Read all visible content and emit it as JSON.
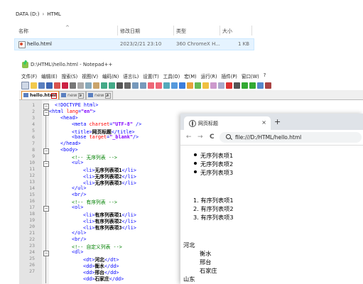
{
  "explorer": {
    "breadcrumb": [
      "DATA (D:)",
      "HTML"
    ],
    "columns": {
      "name": "名称",
      "modified": "修改日期",
      "type": "类型",
      "size": "大小"
    },
    "file": {
      "name": "hello.html",
      "modified": "2023/2/21 23:10",
      "type": "360 ChromeX H...",
      "size": "1 KB"
    }
  },
  "notepad": {
    "title": "D:\\HTML\\hello.html - Notepad++",
    "menu": [
      "文件(F)",
      "编辑(E)",
      "搜索(S)",
      "视图(V)",
      "编码(N)",
      "语言(L)",
      "设置(T)",
      "工具(O)",
      "宏(M)",
      "运行(R)",
      "插件(P)",
      "窗口(W)",
      "?"
    ],
    "tabs": [
      "hello.html",
      "new 1",
      "new 2"
    ],
    "line_numbers": [
      "1",
      "2",
      "3",
      "4",
      "5",
      "6",
      "7",
      "8",
      "9",
      "10",
      "11",
      "12",
      "13",
      "14",
      "15",
      "16",
      "17",
      "18",
      "19",
      "20",
      "21",
      "22",
      "23",
      "24",
      "25",
      "26",
      "27"
    ],
    "code": {
      "l1": "<!DOCTYPE html>",
      "l2a": "<html ",
      "l2b": "lang",
      "l2c": "=",
      "l2d": "\"en\"",
      "l2e": ">",
      "l3": "<head>",
      "l4a": "<meta ",
      "l4b": "charset",
      "l4c": "=",
      "l4d": "\"UTF-8\"",
      "l4e": " />",
      "l5a": "<title>",
      "l5b": "网页标题",
      "l5c": "</title>",
      "l6a": "<base ",
      "l6b": "target",
      "l6c": "=",
      "l6d": "\"_blank\"",
      "l6e": "/>",
      "l7": "</head>",
      "l8": "<body>",
      "l9": "<!-- 无序列表 -->",
      "l10": "<ul>",
      "l11a": "<li>",
      "l11b": "无序列表项1",
      "l11c": "</li>",
      "l12a": "<li>",
      "l12b": "无序列表项2",
      "l12c": "</li>",
      "l13a": "<li>",
      "l13b": "无序列表项3",
      "l13c": "</li>",
      "l14": "</ul>",
      "l15": "<br/>",
      "l16": "<!-- 有序列表 -->",
      "l17": "<ol>",
      "l18a": "<li>",
      "l18b": "有序列表项1",
      "l18c": "</li>",
      "l19a": "<li>",
      "l19b": "有序列表项2",
      "l19c": "</li>",
      "l20a": "<li>",
      "l20b": "有序列表项3",
      "l20c": "</li>",
      "l21": "</ol>",
      "l22": "<br/>",
      "l23": "<!-- 自定义列表 -->",
      "l24": "<dl>",
      "l25a": "<dt>",
      "l25b": "河北",
      "l25c": "</dt>",
      "l26a": "<dd>",
      "l26b": "衡水",
      "l26c": "</dd>",
      "l27a": "<dd>",
      "l27b": "邢台",
      "l27c": "</dd>",
      "l28a": "<dd>",
      "l28b": "石家庄",
      "l28c": "</dd>"
    }
  },
  "browser": {
    "tab_title": "网页标题",
    "close": "×",
    "new_tab": "+",
    "back": "←",
    "forward": "→",
    "reload": "C",
    "url": "file:///D:/HTML/hello.html",
    "ul_items": [
      "无序列表项1",
      "无序列表项2",
      "无序列表项3"
    ],
    "ol_items": [
      "1. 有序列表项1",
      "2. 有序列表项2",
      "3. 有序列表项3"
    ],
    "dl": {
      "dt1": "河北",
      "dd1": "衡水",
      "dd2": "邢台",
      "dd3": "石家庄",
      "dt2": "山东"
    }
  }
}
